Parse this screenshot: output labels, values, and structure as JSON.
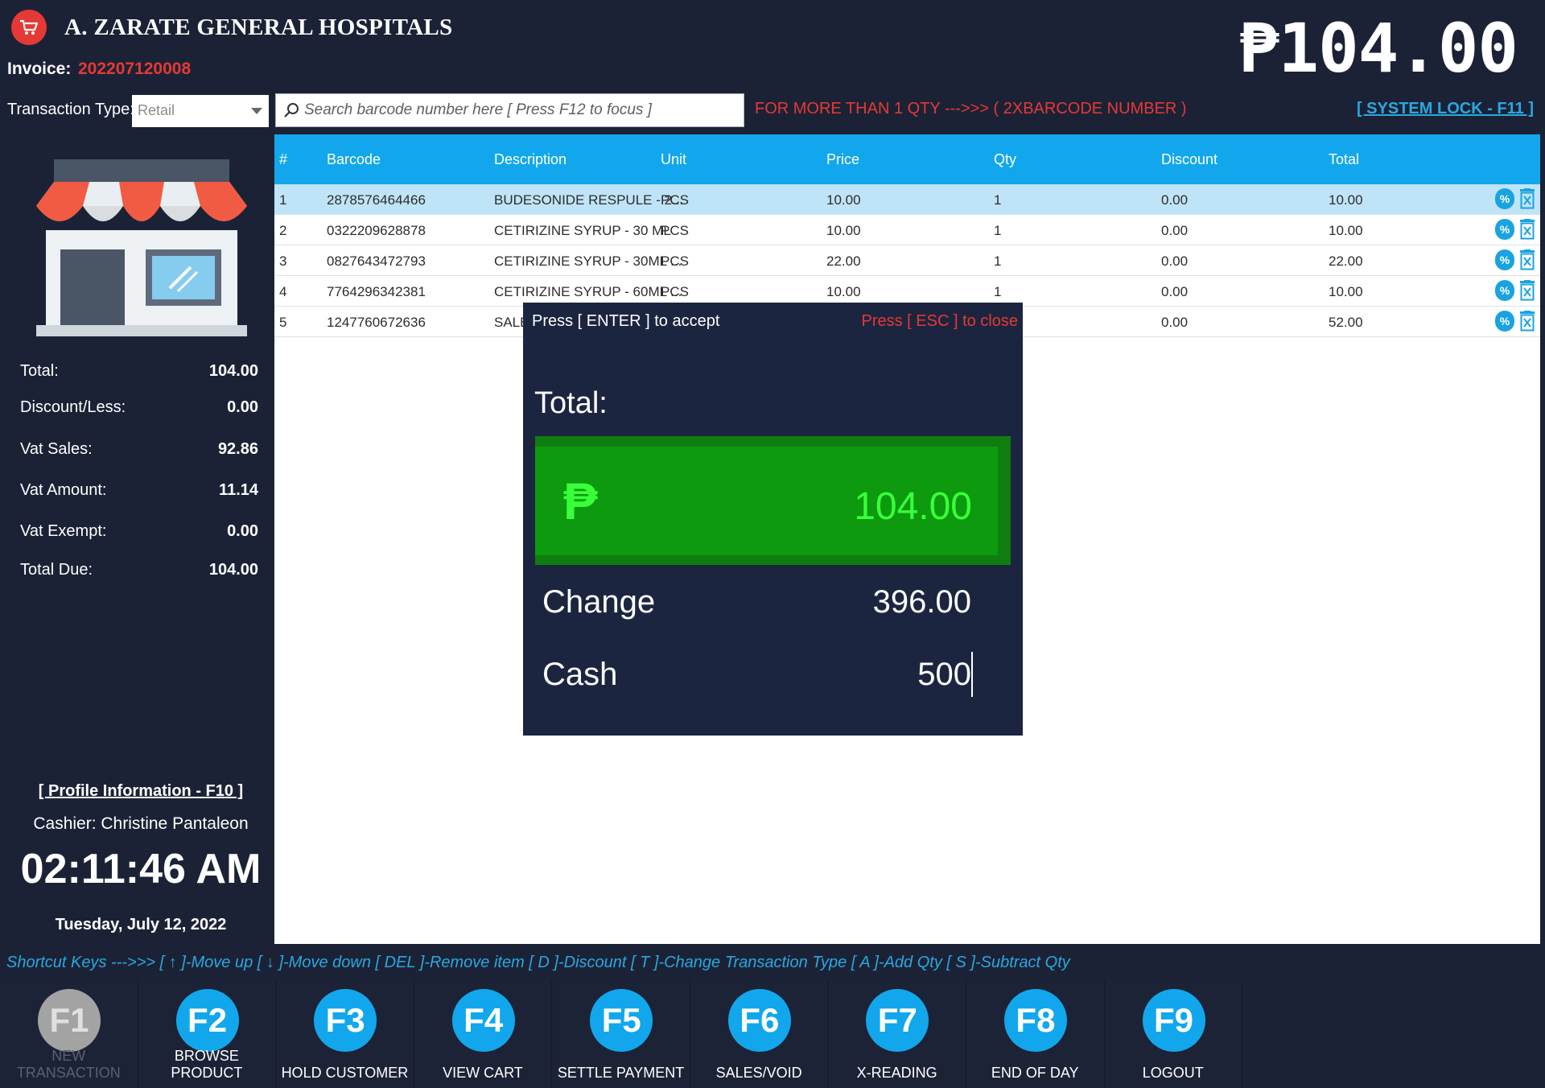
{
  "header": {
    "title": "A. ZARATE GENERAL HOSPITALS",
    "invoice_label": "Invoice:",
    "invoice_number": "202207120008",
    "grand_total": "₱104.00",
    "logo_icon": "cart-icon"
  },
  "toolbar": {
    "transaction_type_label": "Transaction Type:",
    "transaction_type_value": "Retail",
    "search_placeholder": "Search barcode number here [ Press F12 to focus ]",
    "qty_note": "FOR MORE THAN 1 QTY --->>> ( 2XBARCODE NUMBER )",
    "system_lock": "[ SYSTEM LOCK - F11 ]"
  },
  "summary": {
    "total_label": "Total:",
    "total": "104.00",
    "discount_label": "Discount/Less:",
    "discount": "0.00",
    "vat_sales_label": "Vat Sales:",
    "vat_sales": "92.86",
    "vat_amount_label": "Vat Amount:",
    "vat_amount": "11.14",
    "vat_exempt_label": "Vat Exempt:",
    "vat_exempt": "0.00",
    "total_due_label": "Total Due:",
    "total_due": "104.00"
  },
  "profile": {
    "link": "[ Profile Information - F10 ]",
    "cashier": "Cashier: Christine Pantaleon",
    "time": "02:11:46 AM",
    "date": "Tuesday, July 12, 2022"
  },
  "table": {
    "columns": [
      "#",
      "Barcode",
      "Description",
      "Unit",
      "Price",
      "Qty",
      "Discount",
      "Total"
    ],
    "rows": [
      {
        "num": "1",
        "barcode": "2878576464466",
        "description": "BUDESONIDE RESPULE - 2...",
        "unit": "PCS",
        "price": "10.00",
        "qty": "1",
        "discount": "0.00",
        "total": "10.00"
      },
      {
        "num": "2",
        "barcode": "0322209628878",
        "description": "CETIRIZINE SYRUP - 30 ML",
        "unit": "PCS",
        "price": "10.00",
        "qty": "1",
        "discount": "0.00",
        "total": "10.00"
      },
      {
        "num": "3",
        "barcode": "0827643472793",
        "description": "CETIRIZINE SYRUP - 30ML ...",
        "unit": "PCS",
        "price": "22.00",
        "qty": "1",
        "discount": "0.00",
        "total": "22.00"
      },
      {
        "num": "4",
        "barcode": "7764296342381",
        "description": "CETIRIZINE SYRUP - 60ML ...",
        "unit": "PCS",
        "price": "10.00",
        "qty": "1",
        "discount": "0.00",
        "total": "10.00"
      },
      {
        "num": "5",
        "barcode": "1247760672636",
        "description": "SALBU",
        "unit": "",
        "price": "",
        "qty": "",
        "discount": "0.00",
        "total": "52.00"
      }
    ]
  },
  "payment": {
    "enter_hint": "Press [ ENTER ] to accept",
    "esc_hint": "Press [ ESC ] to close",
    "total_label": "Total:",
    "currency_symbol": "₱",
    "amount": "104.00",
    "change_label": "Change",
    "change": "396.00",
    "cash_label": "Cash",
    "cash": "500"
  },
  "shortcuts": "Shortcut Keys --->>> [ ↑ ]-Move up [ ↓ ]-Move down  [ DEL ]-Remove item [ D ]-Discount [ T ]-Change Transaction Type [ A ]-Add Qty [ S ]-Subtract Qty",
  "fkeys": [
    {
      "key": "F1",
      "label": "NEW TRANSACTION"
    },
    {
      "key": "F2",
      "label": "BROWSE PRODUCT"
    },
    {
      "key": "F3",
      "label": "HOLD CUSTOMER"
    },
    {
      "key": "F4",
      "label": "VIEW CART"
    },
    {
      "key": "F5",
      "label": "SETTLE PAYMENT"
    },
    {
      "key": "F6",
      "label": "SALES/VOID"
    },
    {
      "key": "F7",
      "label": "X-READING"
    },
    {
      "key": "F8",
      "label": "END OF DAY"
    },
    {
      "key": "F9",
      "label": "LOGOUT"
    }
  ],
  "colors": {
    "background": "#1c2236",
    "accent_blue": "#12a7ec",
    "alert_red": "#e53935",
    "cash_green": "#39ff3a"
  }
}
